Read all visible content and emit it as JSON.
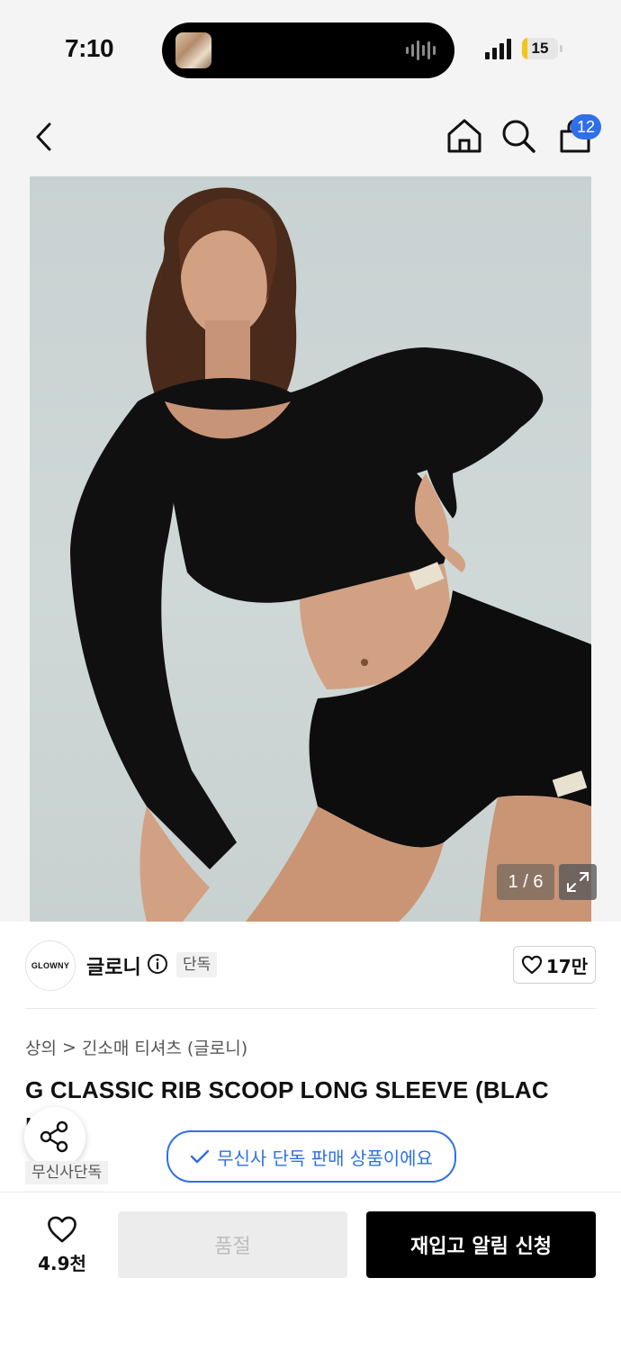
{
  "status_bar": {
    "time": "7:10",
    "battery_level": "15",
    "battery_percent": 15
  },
  "nav": {
    "cart_count": "12"
  },
  "gallery": {
    "counter": "1 / 6"
  },
  "brand": {
    "logo_text": "GLOWNY",
    "name": "글로니",
    "badge": "단독",
    "likes": "17만"
  },
  "breadcrumb": {
    "category": "상의",
    "separator": ">",
    "subcategory": "긴소매 티셔츠 (글로니)"
  },
  "product": {
    "title": "G CLASSIC RIB SCOOP LONG SLEEVE (BLAC",
    "title_overflow": "K",
    "tag": "무신사단독",
    "exclusive_banner": "무신사 단독 판매 상품이에요"
  },
  "bottom_bar": {
    "wish_count": "4.9천",
    "soldout_label": "품절",
    "restock_label": "재입고 알림 신청"
  },
  "colors": {
    "accent_blue": "#2f6fe8",
    "battery_yellow": "#f5c518",
    "cta_black": "#000000"
  }
}
